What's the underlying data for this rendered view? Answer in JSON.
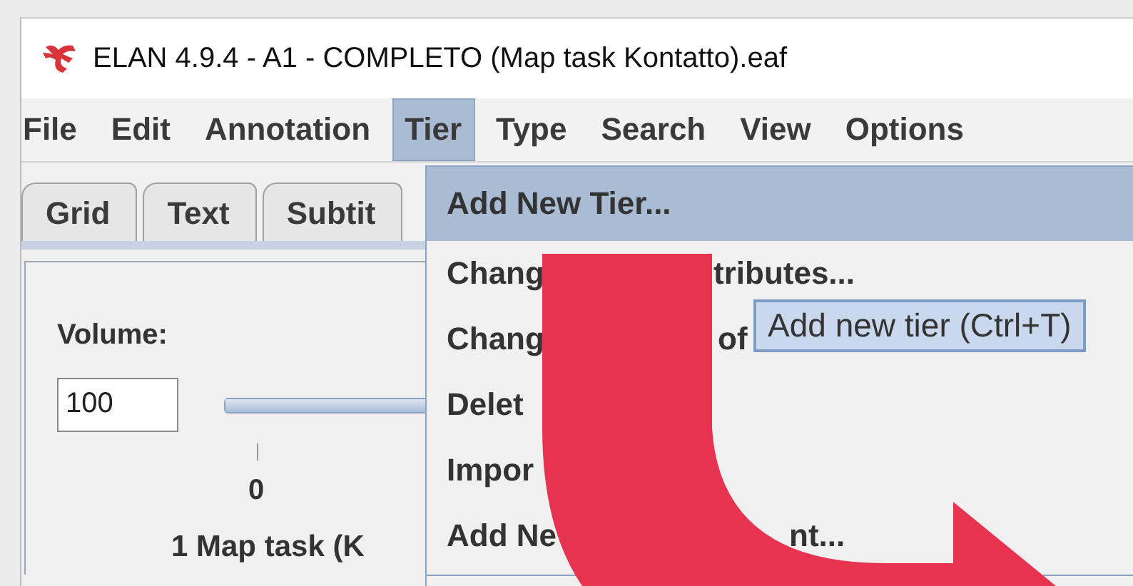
{
  "window": {
    "title": "ELAN 4.9.4 - A1 - COMPLETO (Map task Kontatto).eaf"
  },
  "menu_bar": [
    {
      "label": "File",
      "selected": false
    },
    {
      "label": "Edit",
      "selected": false
    },
    {
      "label": "Annotation",
      "selected": false
    },
    {
      "label": "Tier",
      "selected": true
    },
    {
      "label": "Type",
      "selected": false
    },
    {
      "label": "Search",
      "selected": false
    },
    {
      "label": "View",
      "selected": false
    },
    {
      "label": "Options",
      "selected": false
    }
  ],
  "tabs": [
    {
      "label": "Grid",
      "selected": false
    },
    {
      "label": "Text",
      "selected": false
    },
    {
      "label": "Subtit",
      "selected": false
    }
  ],
  "panel": {
    "volume_label": "Volume:",
    "volume_value": "100",
    "volume_slider": {
      "level": 1
    },
    "tick_label": "0",
    "media_title": "1 Map task (K"
  },
  "tier_menu": [
    {
      "parts": [
        "Add New Tier..."
      ],
      "selected": true
    },
    {
      "parts": [
        "Chang",
        "tributes..."
      ],
      "selected": false
    },
    {
      "parts": [
        "Chang",
        "of"
      ],
      "selected": false
    },
    {
      "parts": [
        "Delet"
      ],
      "selected": false
    },
    {
      "parts": [
        "Impor"
      ],
      "selected": false
    },
    {
      "parts": [
        "Add Ne",
        "nt..."
      ],
      "selected": false
    }
  ],
  "tooltip": "Add new tier (Ctrl+T)"
}
